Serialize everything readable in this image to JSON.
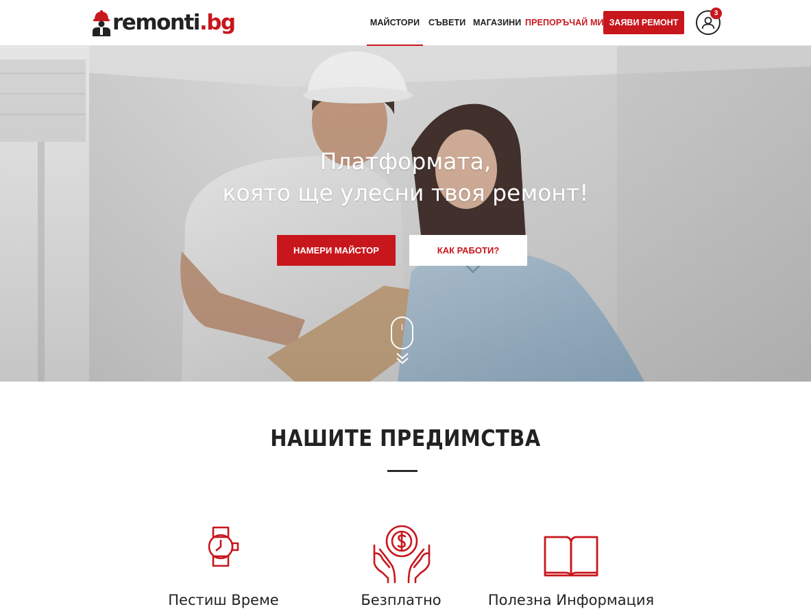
{
  "brand": {
    "logo_main": "remonti",
    "logo_tld": ".bg"
  },
  "nav": {
    "items": [
      {
        "label": "МАЙСТОРИ",
        "active": true,
        "color": "#1d1d1d"
      },
      {
        "label": "СЪВЕТИ",
        "active": false,
        "color": "#1d1d1d"
      },
      {
        "label": "МАГАЗИНИ",
        "active": false,
        "color": "#1d1d1d"
      },
      {
        "label": "ПРЕПОРЪЧАЙ МИ",
        "active": false,
        "color": "#c8161d"
      }
    ],
    "cta_label": "ЗАЯВИ РЕМОНТ",
    "user_icon": "user-circle-icon",
    "notification_count": "3"
  },
  "hero": {
    "title_line1": "Платформата,",
    "title_line2": "която ще улесни твоя ремонт!",
    "primary_button": "НАМЕРИ МАЙСТОР",
    "secondary_button": "КАК РАБОТИ?",
    "scroll_icon": "mouse-scroll-icon"
  },
  "advantages": {
    "title": "НАШИТЕ ПРЕДИМСТВА",
    "items": [
      {
        "label": "Пестиш Време",
        "icon": "watch-icon"
      },
      {
        "label": "Безплатно",
        "icon": "hands-coin-icon"
      },
      {
        "label": "Полезна Информация",
        "icon": "open-book-icon"
      }
    ]
  },
  "colors": {
    "accent": "#c8161d",
    "text": "#222222",
    "header_bg": "#ffffff"
  }
}
